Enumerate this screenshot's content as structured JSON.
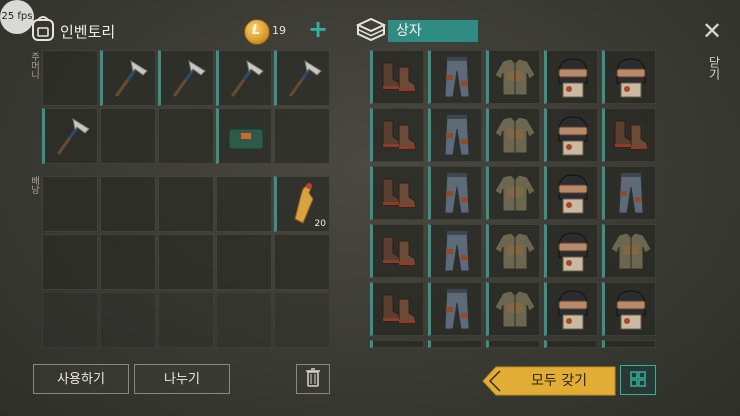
{
  "overlay": {
    "fps": "25 fps"
  },
  "inventory": {
    "title": "인벤토리",
    "icon": "backpack-icon",
    "coins": "19",
    "add_icon": "plus-icon",
    "pocket_label": "주머니",
    "backpack_label": "배낭",
    "pocket_slots": [
      {
        "item": "empty"
      },
      {
        "item": "hatchet-icon"
      },
      {
        "item": "hatchet-icon"
      },
      {
        "item": "hatchet-icon"
      },
      {
        "item": "hatchet-icon"
      },
      {
        "item": "hatchet-icon"
      },
      {
        "item": "empty"
      },
      {
        "item": "empty"
      },
      {
        "item": "toolbox-icon"
      },
      {
        "item": "empty"
      }
    ],
    "backpack_slots": [
      {
        "item": "empty"
      },
      {
        "item": "empty"
      },
      {
        "item": "empty"
      },
      {
        "item": "empty"
      },
      {
        "item": "water-bottle-icon",
        "count": "20"
      }
    ]
  },
  "chest": {
    "title": "상자",
    "icon": "crate-icon",
    "rows": [
      [
        "boots-icon",
        "pants-icon",
        "jacket-icon",
        "helmet-icon",
        "helmet-icon"
      ],
      [
        "boots-icon",
        "pants-icon",
        "jacket-icon",
        "helmet-icon",
        "boots-icon"
      ],
      [
        "boots-icon",
        "pants-icon",
        "jacket-icon",
        "helmet-icon",
        "pants-icon"
      ],
      [
        "boots-icon",
        "pants-icon",
        "jacket-icon",
        "helmet-icon",
        "jacket-icon"
      ],
      [
        "boots-icon",
        "pants-icon",
        "jacket-icon",
        "helmet-icon",
        "helmet-icon"
      ]
    ]
  },
  "close": {
    "icon": "close-icon",
    "label": "닫기"
  },
  "actions": {
    "use_label": "사용하기",
    "split_label": "나누기",
    "trash_icon": "trash-icon",
    "take_all_label": "모두 갖기",
    "grid_icon": "grid-view-icon"
  },
  "colors": {
    "accent": "#2f8c82",
    "take_all": "#e2ad35"
  }
}
